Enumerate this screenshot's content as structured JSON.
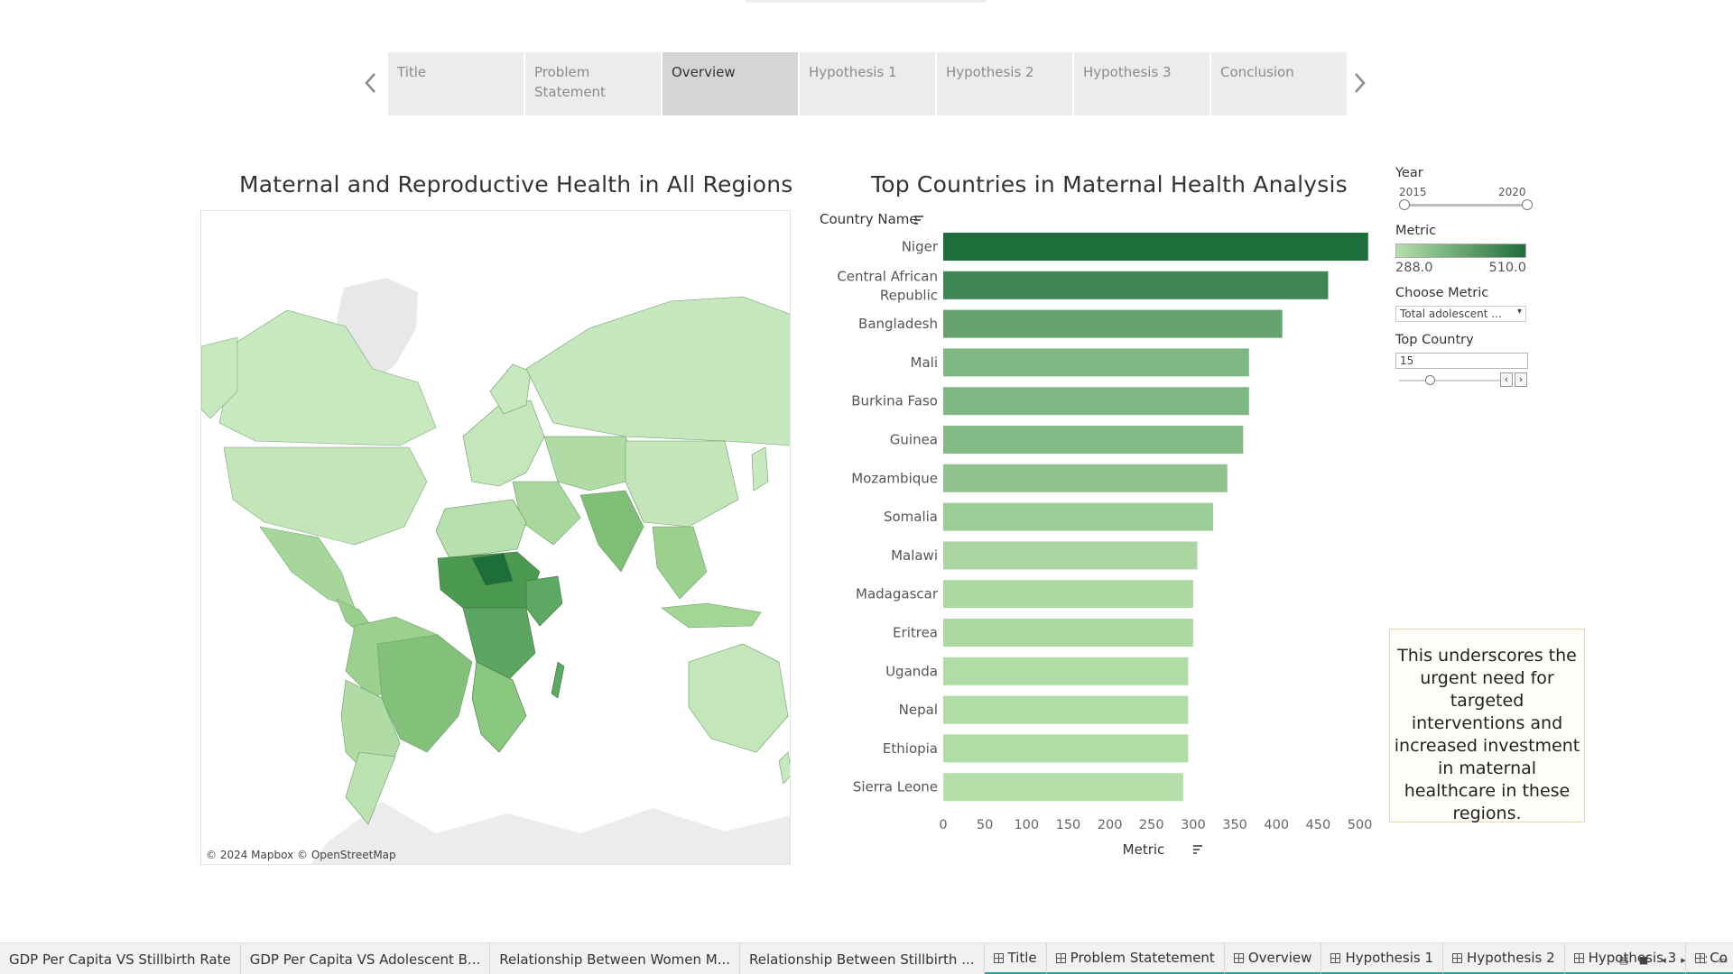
{
  "story_points": [
    {
      "label": "Title"
    },
    {
      "label": "Problem Statement"
    },
    {
      "label": "Overview"
    },
    {
      "label": "Hypothesis 1"
    },
    {
      "label": "Hypothesis 2"
    },
    {
      "label": "Hypothesis 3"
    },
    {
      "label": "Conclusion"
    }
  ],
  "active_story_point": "Overview",
  "map": {
    "title": "Maternal and Reproductive Health in All Regions",
    "credit": "© 2024 Mapbox © OpenStreetMap"
  },
  "chart": {
    "title": "Top Countries in Maternal Health Analysis",
    "y_header": "Country Name",
    "x_title": "Metric"
  },
  "chart_data": {
    "type": "bar",
    "orientation": "horizontal",
    "title": "Top Countries in Maternal Health Analysis",
    "xlabel": "Metric",
    "ylabel": "Country Name",
    "categories": [
      "Niger",
      "Central African Republic",
      "Bangladesh",
      "Mali",
      "Burkina Faso",
      "Guinea",
      "Mozambique",
      "Somalia",
      "Malawi",
      "Madagascar",
      "Eritrea",
      "Uganda",
      "Nepal",
      "Ethiopia",
      "Sierra Leone"
    ],
    "values": [
      510,
      462,
      407,
      367,
      367,
      360,
      341,
      324,
      305,
      300,
      300,
      294,
      294,
      294,
      288
    ],
    "x_ticks": [
      0,
      50,
      100,
      150,
      200,
      250,
      300,
      350,
      400,
      450,
      500
    ],
    "xlim": [
      0,
      520
    ],
    "color_scale": {
      "min": 288.0,
      "max": 510.0,
      "low_color": "#b4dfa8",
      "high_color": "#1e6e3c"
    },
    "grid": false
  },
  "filters": {
    "year": {
      "title": "Year",
      "min": "2015",
      "max": "2020"
    },
    "metric_legend": {
      "title": "Metric",
      "min": "288.0",
      "max": "510.0"
    },
    "choose_metric": {
      "title": "Choose Metric",
      "value": "Total adolescent ..."
    },
    "top_country": {
      "title": "Top Country",
      "value": "15",
      "level": 0.3
    }
  },
  "annotation": "This underscores the urgent need for targeted interventions and increased investment in maternal healthcare in these regions.",
  "tabs": [
    {
      "label": "GDP Per Capita VS Stillbirth Rate",
      "story": false
    },
    {
      "label": "GDP Per Capita VS Adolescent B...",
      "story": false
    },
    {
      "label": "Relationship Between Women M...",
      "story": false
    },
    {
      "label": "Relationship Between Stillbirth ...",
      "story": false
    },
    {
      "label": "Title",
      "story": true
    },
    {
      "label": "Problem Statetement",
      "story": true
    },
    {
      "label": "Overview",
      "story": true
    },
    {
      "label": "Hypothesis 1",
      "story": true
    },
    {
      "label": "Hypothesis 2",
      "story": true
    },
    {
      "label": "Hypothesis 3",
      "story": true
    },
    {
      "label": "Co",
      "story": true
    }
  ]
}
